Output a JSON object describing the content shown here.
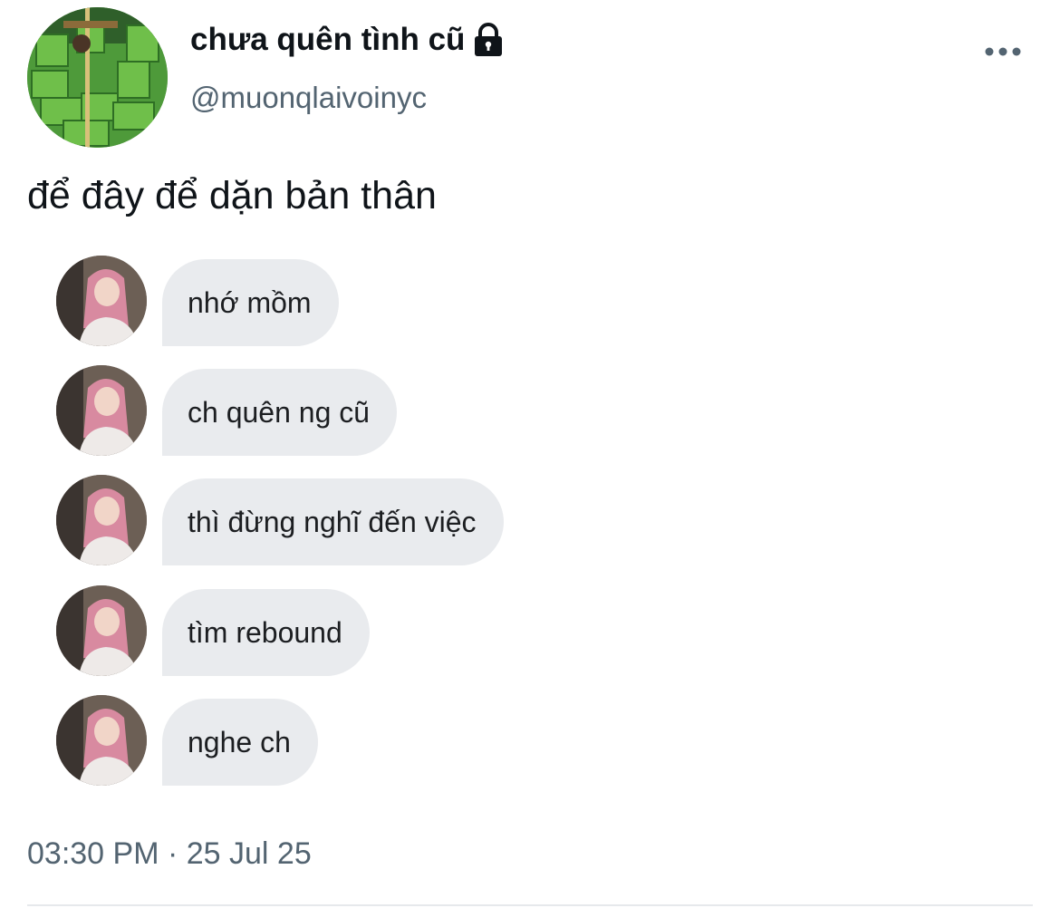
{
  "author": {
    "display_name": "chưa quên tình cũ",
    "handle": "@muonqlaivoinyc",
    "protected_icon": "lock-icon",
    "avatar_icon": "profile-photo"
  },
  "header": {
    "more_icon": "more-horizontal-icon"
  },
  "tweet": {
    "text": "để đây để dặn bản thân",
    "messages": [
      {
        "text": "nhớ mồm"
      },
      {
        "text": "ch quên ng cũ"
      },
      {
        "text": "thì đừng nghĩ đến việc"
      },
      {
        "text": "tìm rebound"
      },
      {
        "text": "nghe ch"
      }
    ],
    "timestamp": "03:30 PM · 25 Jul 25"
  },
  "colors": {
    "bubble_bg": "#e9ebee",
    "secondary_text": "#536471",
    "primary_text": "#0f1419",
    "divider": "#e6e9ec"
  }
}
